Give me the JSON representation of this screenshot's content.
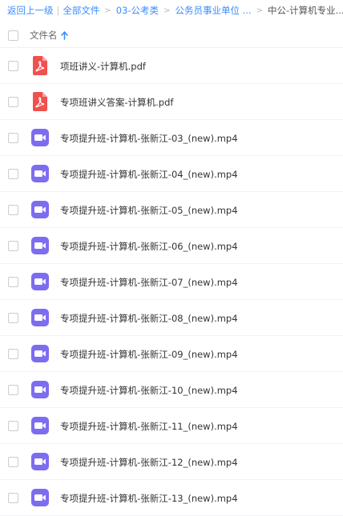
{
  "breadcrumb": {
    "back": "返回上一级",
    "items": [
      "全部文件",
      "03-公考类",
      "公务员事业单位 ...",
      "中公-计算机专业..."
    ]
  },
  "header": {
    "column_name": "文件名",
    "sort_icon": "arrow-up-icon"
  },
  "colors": {
    "link": "#3b8cff",
    "pdf_icon": "#f0504e",
    "video_icon": "#7c6cf2"
  },
  "files": [
    {
      "name": "项班讲义-计算机.pdf",
      "type": "pdf",
      "icon": "pdf-icon"
    },
    {
      "name": "专项班讲义答案-计算机.pdf",
      "type": "pdf",
      "icon": "pdf-icon"
    },
    {
      "name": "专项提升班-计算机-张新江-03_(new).mp4",
      "type": "video",
      "icon": "video-icon"
    },
    {
      "name": "专项提升班-计算机-张新江-04_(new).mp4",
      "type": "video",
      "icon": "video-icon"
    },
    {
      "name": "专项提升班-计算机-张新江-05_(new).mp4",
      "type": "video",
      "icon": "video-icon"
    },
    {
      "name": "专项提升班-计算机-张新江-06_(new).mp4",
      "type": "video",
      "icon": "video-icon"
    },
    {
      "name": "专项提升班-计算机-张新江-07_(new).mp4",
      "type": "video",
      "icon": "video-icon"
    },
    {
      "name": "专项提升班-计算机-张新江-08_(new).mp4",
      "type": "video",
      "icon": "video-icon"
    },
    {
      "name": "专项提升班-计算机-张新江-09_(new).mp4",
      "type": "video",
      "icon": "video-icon"
    },
    {
      "name": "专项提升班-计算机-张新江-10_(new).mp4",
      "type": "video",
      "icon": "video-icon"
    },
    {
      "name": "专项提升班-计算机-张新江-11_(new).mp4",
      "type": "video",
      "icon": "video-icon"
    },
    {
      "name": "专项提升班-计算机-张新江-12_(new).mp4",
      "type": "video",
      "icon": "video-icon"
    },
    {
      "name": "专项提升班-计算机-张新江-13_(new).mp4",
      "type": "video",
      "icon": "video-icon"
    }
  ]
}
